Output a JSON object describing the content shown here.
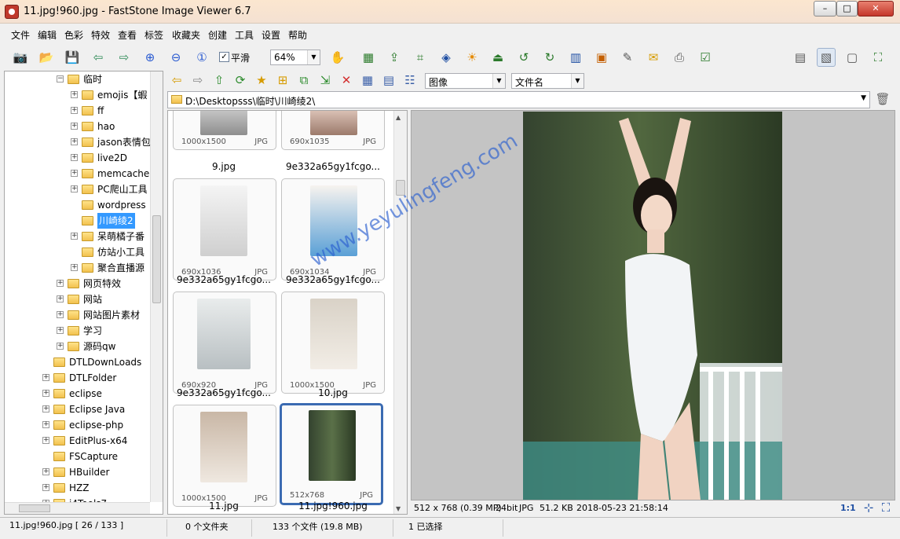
{
  "window": {
    "title": "11.jpg!960.jpg  -  FastStone Image Viewer 6.7",
    "min": "–",
    "max": "□",
    "close": "✕"
  },
  "menu": [
    "文件",
    "编辑",
    "色彩",
    "特效",
    "查看",
    "标签",
    "收藏夹",
    "创建",
    "工具",
    "设置",
    "帮助"
  ],
  "toolbar": {
    "smooth_label": "平滑",
    "smooth_checked": "✓",
    "zoom_value": "64%"
  },
  "nav": {
    "view_combo": "图像",
    "sort_combo": "文件名",
    "path": "D:\\Desktopsss\\临时\\川崎绫2\\"
  },
  "tree": [
    {
      "label": "临时",
      "expand": "−"
    },
    {
      "label": "emojis【蝦",
      "expand": "+"
    },
    {
      "label": "ff",
      "expand": "+"
    },
    {
      "label": "hao",
      "expand": "+"
    },
    {
      "label": "jason表情包",
      "expand": "+"
    },
    {
      "label": "live2D",
      "expand": "+"
    },
    {
      "label": "memcached",
      "expand": "+"
    },
    {
      "label": "PC爬山工具",
      "expand": "+"
    },
    {
      "label": "wordpress",
      "expand": ""
    },
    {
      "label": "川崎绫2",
      "expand": ""
    },
    {
      "label": "呆萌橘子番",
      "expand": "+"
    },
    {
      "label": "仿站小工具",
      "expand": ""
    },
    {
      "label": "聚合直播源",
      "expand": "+"
    },
    {
      "label": "网页特效",
      "expand": "+"
    },
    {
      "label": "网站",
      "expand": "+"
    },
    {
      "label": "网站图片素材",
      "expand": "+"
    },
    {
      "label": "学习",
      "expand": "+"
    },
    {
      "label": "源码qw",
      "expand": "+"
    },
    {
      "label": "DTLDownLoads",
      "expand": ""
    },
    {
      "label": "DTLFolder",
      "expand": "+"
    },
    {
      "label": "eclipse",
      "expand": "+"
    },
    {
      "label": "Eclipse Java",
      "expand": "+"
    },
    {
      "label": "eclipse-php",
      "expand": "+"
    },
    {
      "label": "EditPlus-x64",
      "expand": "+"
    },
    {
      "label": "FSCapture",
      "expand": ""
    },
    {
      "label": "HBuilder",
      "expand": "+"
    },
    {
      "label": "HZZ",
      "expand": "+"
    },
    {
      "label": "i4Tools7",
      "expand": "+"
    }
  ],
  "thumbnails": [
    {
      "dims": "1000x1500",
      "ext": "JPG",
      "name": "9.jpg"
    },
    {
      "dims": "690x1035",
      "ext": "JPG",
      "name": "9e332a65gy1fcgo..."
    },
    {
      "dims": "690x1036",
      "ext": "JPG",
      "name": "9e332a65gy1fcgo..."
    },
    {
      "dims": "690x1034",
      "ext": "JPG",
      "name": "9e332a65gy1fcgo..."
    },
    {
      "dims": "690x920",
      "ext": "JPG",
      "name": "9e332a65gy1fcgo..."
    },
    {
      "dims": "1000x1500",
      "ext": "JPG",
      "name": "10.jpg"
    },
    {
      "dims": "1000x1500",
      "ext": "JPG",
      "name": "11.jpg"
    },
    {
      "dims": "512x768",
      "ext": "JPG",
      "name": "11.jpg!960.jpg"
    }
  ],
  "viewer": {
    "watermark": "www.yeyulingfeng.com"
  },
  "image_info": {
    "size": "512 x 768 (0.39 MP)",
    "depth": "24bit",
    "format": "JPG",
    "filesize": "51.2 KB",
    "datetime": "2018-05-23 21:58:14",
    "zoom": "1:1"
  },
  "status": {
    "file": "11.jpg!960.jpg [ 26 / 133 ]",
    "folders": "0 个文件夹",
    "files": "133 个文件 (19.8 MB)",
    "selected": "1 已选择"
  }
}
